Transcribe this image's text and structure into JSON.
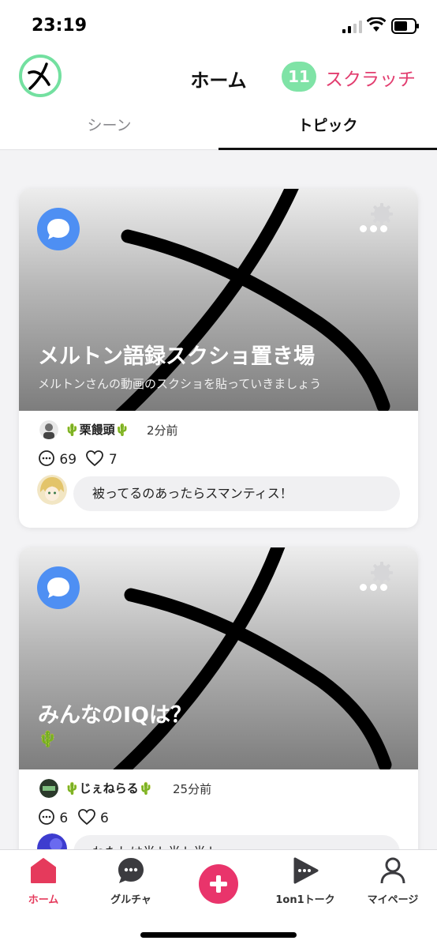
{
  "status_bar": {
    "time": "23:19"
  },
  "header": {
    "title": "ホーム",
    "online_count": "11人",
    "scratch_label": "スクラッチ",
    "brand_color": "#73e0a0",
    "accent_color": "#e23d6f"
  },
  "tabs": [
    {
      "label": "シーン",
      "active": false
    },
    {
      "label": "トピック",
      "active": true
    }
  ],
  "cards": [
    {
      "title": "メルトン語録スクショ置き場",
      "subtitle": "メルトンさんの動画のスクショを貼っていきましょう",
      "author": "🌵栗饅頭🌵",
      "time_ago": "2分前",
      "comments": "69",
      "likes": "7",
      "latest_comment": "被ってるのあったらスマンティス！"
    },
    {
      "title": "みんなのIQは？",
      "subtitle": "🌵",
      "author": "🌵じぇねらる🌵",
      "time_ago": "25分前",
      "comments": "6",
      "likes": "6",
      "latest_comment": "わたしは半ト半ト半ト"
    }
  ],
  "bottom_nav": [
    {
      "label": "ホーム",
      "icon": "home-icon",
      "active": true
    },
    {
      "label": "グルチャ",
      "icon": "group-chat-icon",
      "active": false
    },
    {
      "label": "",
      "icon": "plus-icon",
      "active": false
    },
    {
      "label": "1on1トーク",
      "icon": "one-on-one-icon",
      "active": false
    },
    {
      "label": "マイページ",
      "icon": "profile-icon",
      "active": false
    }
  ]
}
